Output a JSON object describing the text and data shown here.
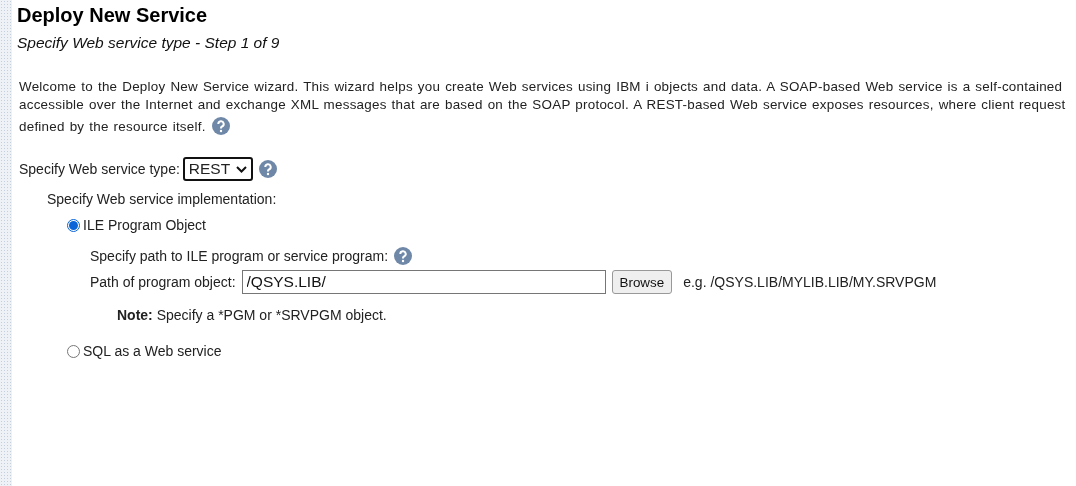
{
  "title": "Deploy New Service",
  "subtitle": "Specify Web service type - Step 1 of 9",
  "intro_lines": [
    "Welcome to the Deploy New Service wizard. This wizard helps you create Web services using IBM i objects and data. A SOAP-based Web service is a self-contained",
    "accessible over the Internet and exchange XML messages that are based on the SOAP protocol. A REST-based Web service exposes resources, where client request",
    "defined by the resource itself."
  ],
  "service_type": {
    "label": "Specify Web service type:",
    "value": "REST"
  },
  "implementation": {
    "label": "Specify Web service implementation:",
    "options": [
      {
        "label": "ILE Program Object",
        "selected": true
      },
      {
        "label": "SQL as a Web service",
        "selected": false
      }
    ],
    "path_prompt": "Specify path to ILE program or service program:",
    "path_label": "Path of program object:",
    "path_value": "/QSYS.LIB/",
    "browse": "Browse",
    "example": "e.g. /QSYS.LIB/MYLIB.LIB/MY.SRVPGM",
    "note": "**Note:** Specify a *PGM or *SRVPGM object."
  }
}
